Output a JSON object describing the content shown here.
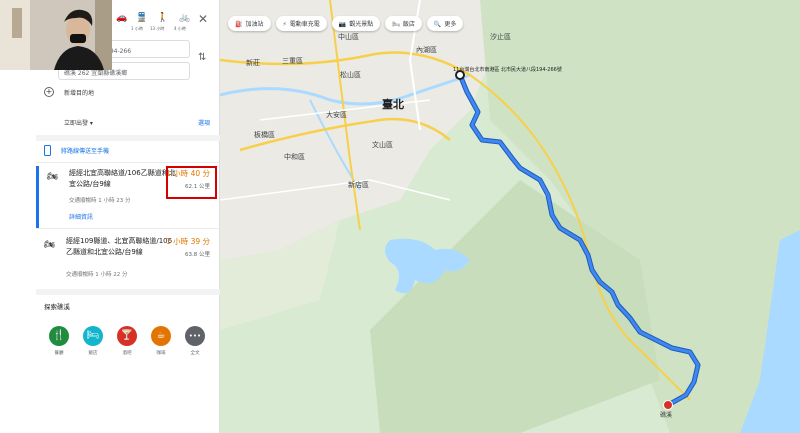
{
  "modes": [
    {
      "icon": "car-icon",
      "glyph": "🚗",
      "time": ""
    },
    {
      "icon": "transit-icon",
      "glyph": "🚆",
      "time": "1 小時"
    },
    {
      "icon": "walk-icon",
      "glyph": "🚶",
      "time": "13 小時"
    },
    {
      "icon": "bicycle-icon",
      "glyph": "🚲",
      "time": "4 小時"
    }
  ],
  "origin": {
    "value": "北市民大道八段194-266"
  },
  "destination": {
    "value": "礁溪 262 宜蘭縣礁溪鄉"
  },
  "add_destination": "新增目的地",
  "depart": {
    "label": "立即出發 ▾",
    "options": "選項"
  },
  "send_to_phone": "將路線傳送至手機",
  "routes": [
    {
      "title": "經經北宜高聯絡道/106乙縣道和北宜公路/台9線",
      "time": "1 小時 40 分",
      "distance": "62.1 公里",
      "note": "交通順暢時 1 小時 23 分",
      "details": "詳細資訊"
    },
    {
      "title": "經經109縣道、北宜高聯絡道/106乙縣道和北宜公路/台9線",
      "time": "1 小時 39 分",
      "distance": "63.8 公里",
      "note": "交通順暢時 1 小時 22 分",
      "details": ""
    }
  ],
  "explore": {
    "title": "探索礁溪",
    "categories": [
      {
        "label": "餐廳",
        "icon": "restaurant-icon",
        "glyph": "🍴",
        "color": "#1e8e3e"
      },
      {
        "label": "飯店",
        "icon": "hotel-icon",
        "glyph": "🛏",
        "color": "#12b5cb"
      },
      {
        "label": "酒吧",
        "icon": "bar-icon",
        "glyph": "🍸",
        "color": "#d93025"
      },
      {
        "label": "咖啡",
        "icon": "cafe-icon",
        "glyph": "☕",
        "color": "#e37400"
      },
      {
        "label": "全文",
        "icon": "more-icon",
        "glyph": "•••",
        "color": "#5f6368"
      }
    ]
  },
  "map_chips": [
    {
      "label": "加油站",
      "glyph": "⛽"
    },
    {
      "label": "電動車充電",
      "glyph": "⚡"
    },
    {
      "label": "觀光景點",
      "glyph": "📷"
    },
    {
      "label": "飯店",
      "glyph": "🛏"
    },
    {
      "label": "更多",
      "glyph": "🔍"
    }
  ],
  "map_labels": {
    "taipei": "臺北",
    "zhongshan": "中山區",
    "neihu": "內湖區",
    "xizhi": "汐止區",
    "sanchong": "三重區",
    "xinzhuang": "新莊",
    "songshan": "松山區",
    "daan": "大安區",
    "banqiao": "板橋區",
    "wenshan": "文山區",
    "zhonghe": "中和區",
    "xindian": "新店區",
    "start_addr": "11台灣台北市南港區\n北市民大道八段194-266號",
    "end": "礁溪"
  },
  "colors": {
    "route": "#4285f4",
    "route_outline": "#1a5fb4",
    "accent": "#1a73e8",
    "time": "#e37400",
    "highlight": "#d50000"
  }
}
